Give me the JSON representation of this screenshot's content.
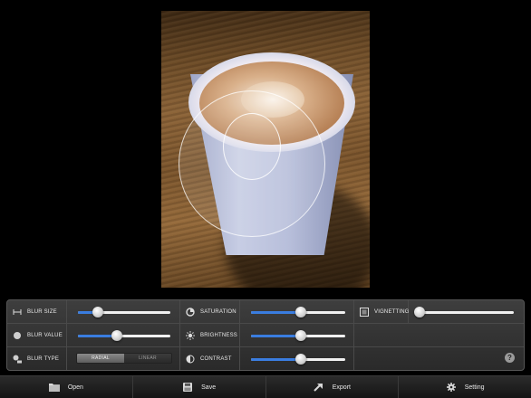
{
  "photo": {
    "description_icon": "latte-cup-photo"
  },
  "controls": {
    "blur_size": {
      "label": "BLUR SIZE",
      "icon": "width-arrows-icon",
      "value": 0.22
    },
    "blur_value": {
      "label": "BLUR VALUE",
      "icon": "circle-dot-icon",
      "value": 0.42
    },
    "blur_type": {
      "label": "BLUR TYPE",
      "icon": "blur-type-icon",
      "options": [
        "RADIAL",
        "LINEAR"
      ],
      "selected": "RADIAL"
    },
    "saturation": {
      "label": "SATURATION",
      "icon": "saturation-icon",
      "value": 0.53
    },
    "brightness": {
      "label": "BRIGHTNESS",
      "icon": "sun-icon",
      "value": 0.53
    },
    "contrast": {
      "label": "CONTRAST",
      "icon": "contrast-icon",
      "value": 0.53
    },
    "vignetting": {
      "label": "VIGNETTING",
      "icon": "vignette-icon",
      "value": 0.0
    },
    "help": {
      "label": "?"
    }
  },
  "toolbar": {
    "open": {
      "label": "Open",
      "icon": "folder-icon"
    },
    "save": {
      "label": "Save",
      "icon": "floppy-icon"
    },
    "export": {
      "label": "Export",
      "icon": "export-icon"
    },
    "setting": {
      "label": "Setting",
      "icon": "gear-icon"
    }
  },
  "colors": {
    "accent": "#3a7de0",
    "panel": "#333333",
    "background": "#000000"
  }
}
